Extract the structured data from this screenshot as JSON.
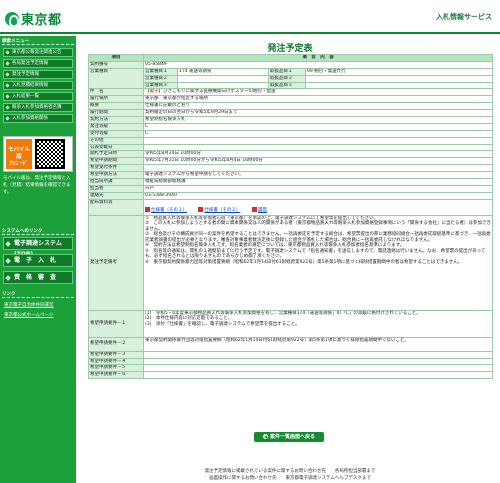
{
  "header": {
    "logo_text": "東京都",
    "service_name": "入札情報サービス"
  },
  "sidebar": {
    "head1": "検索メニュー",
    "items": [
      "東京都公報発注関連公告",
      "各局発注予定情報",
      "発注予定情報",
      "入札見積結果情報",
      "入札結果一覧",
      "競争入札参加資格者名簿",
      "入札参加資格関係"
    ],
    "mobile_label": "モバイル版",
    "mobile_tag": "ｱﾝｺ ｰﾄﾞ",
    "mobile_note": "モバイル版は、発注予定情報と入札（見積）結果情報を確認できます。",
    "head2": "システムへのリンク",
    "big_items": [
      "電子調達システム(TOP)",
      "電　子　入　札",
      "資　格　審　査"
    ],
    "head3": "リンク",
    "links": [
      "東京電子自治体共同運営",
      "東京都公式ホームページ"
    ]
  },
  "main": {
    "title": "発注予定表",
    "col_item": "項目",
    "col_content": "項　目　内　容",
    "rows": {
      "contract_no": {
        "label": "契約番号",
        "value": "05-85849"
      },
      "business_type": {
        "label": "営業種目",
        "sub": [
          "営業種目１",
          "営業種目２",
          "営業種目３"
        ],
        "val": [
          "174 運送等請負",
          "",
          ""
        ],
        "sub2": [
          "取扱品目１",
          "取扱品目２",
          "取扱品目３"
        ],
        "val2": [
          "09 梱包・発送代行",
          "",
          ""
        ]
      },
      "subject": {
        "label": "件　名",
        "tag": "【電子】",
        "value": "ひきこもりに関する医療機関向けポスターの梱包・配送"
      },
      "place": {
        "label": "履行場所",
        "value": "東京都　東京都が指定する場所"
      },
      "outline": {
        "label": "概要",
        "value": "仕様書に記載のとおり"
      },
      "period": {
        "label": "履行期間",
        "value": "契約確定の日の翌日から令和5年9月29日まで"
      },
      "method": {
        "label": "契約方法",
        "value": "希望制指名競争入札"
      },
      "issuer": {
        "label": "発注等級",
        "value": "C"
      },
      "receipt": {
        "label": "受付等級",
        "value": "C"
      },
      "other": {
        "label": "その他",
        "value": ""
      },
      "pub_period": {
        "label": "公表受載日",
        "value": ""
      },
      "open_date": {
        "label": "開札予定日時",
        "value": "令和5年8月24日 10時00分"
      },
      "app_period": {
        "label": "希望申請期間",
        "value": "令和5年7月31日 10時00分から令和5年8月4日 16時00分"
      },
      "app_conditions": {
        "label": "希望受付条件",
        "value": ""
      },
      "app_method": {
        "label": "希望申請方法",
        "value": "電子調達システムから希望申請をしてください。"
      },
      "dept": {
        "label": "担当局所課",
        "value": "福祉局総務部総務課"
      },
      "person": {
        "label": "担当者",
        "value": "宍戸"
      },
      "tel": {
        "label": "連絡先",
        "value": "03-5388-3940"
      },
      "docs": {
        "label": "配布資料等",
        "links": [
          "仕様書（その１）",
          "仕様書（その２）",
          "図面"
        ]
      },
      "notes": {
        "label": "発注予定備考",
        "value": "①　物品買入れ等競争入札等参加者心得（東京都）を承認の上、電子調達システムにて希望票を提出してください。\n②　この入札に参加しようとする者の間に資本関係又は人的関係がある者（東京都物品買入れ等競争入札参加資格登録事項にいう「関係する会社」に当たる者）は参加できません。\n③　総合及びその構成員が同一の案件を希望することはできません。一括再委託を予定する総合は、希望票提出の際に業務協同組合一括再委託取扱基準に基づき、一括再委託業者調書の提出が必要となります。審査対象事業者数決定後に登録した組合が落札した場合は、総合員に一括再委託しなければなりません。\n④　契約方法は希望制指名競争入札です。指名業者の選定については、東京都物品買入れ等競争入札参加者指名基準によります。\n⑤　指名等の通知は、開札の１週間前までに行う予定です。電子調達システムで「指名通知書」を送信しますので、電話連絡は行いません。なお、希望票の提出があっても、必ず指名されるとは限りませんのであらかじめ御了承ください。\n⑥　東京都契約関係暴力団等対策措置要綱（昭和62年1月14日付61財経庶第922号）第5条第1項に基づく排除措置期間中の者は希望することはできません。"
      },
      "req1": {
        "label": "希望申請要件－１",
        "value": "(1)　令和5・6年度東京都物品買入れ等競争入札参加資格を有し、営業種目174「運送等請負」の「C」の等級に格付けされていること。\n(2)　本件仕様内容に対応可能であること。\n(3)　添付「仕様書」を確認し、電子調達システムで希望票を提出すること。"
      },
      "req2": {
        "label": "希望申請要件－２",
        "value": "東京都契約関係暴力団等対策措置要綱（昭和62年1月14日付61財経庶第922号）第5条第1項に基づく排除措置期間中でないこと。"
      },
      "req3": {
        "label": "希望申請要件－３",
        "value": ""
      },
      "req4": {
        "label": "希望申請要件－４",
        "value": ""
      },
      "req5": {
        "label": "希望申請要件－５",
        "value": ""
      },
      "req6": {
        "label": "希望申請要件－６",
        "value": ""
      }
    },
    "back_button": "案件一覧画面へ戻る"
  },
  "footer": {
    "line1": "発注予定情報に掲載されている案件に関するお問い合わせ先　　各局所担当部署まで",
    "line2": "画面操作に関するお問い合わせ先　　東京都電子調達システムヘルプデスクまで"
  }
}
